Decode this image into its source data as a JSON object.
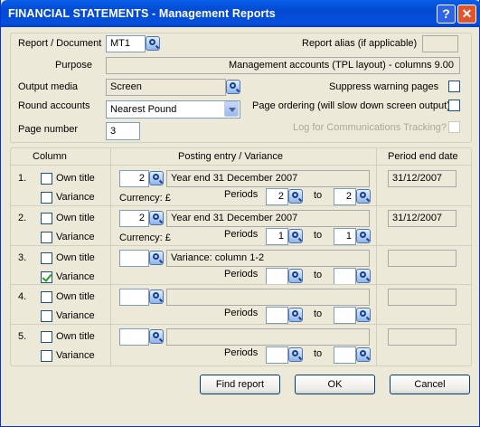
{
  "window": {
    "title": "FINANCIAL STATEMENTS - Management Reports",
    "help_label": "?",
    "close_label": "✕"
  },
  "header": {
    "report_document_label": "Report / Document",
    "report_document_value": "MT1",
    "report_alias_label": "Report alias (if applicable)",
    "report_alias_value": "",
    "purpose_label": "Purpose",
    "purpose_value": "Management accounts (TPL layout) - columns 9.00",
    "output_media_label": "Output media",
    "output_media_value": "Screen",
    "suppress_label": "Suppress warning pages",
    "round_accounts_label": "Round accounts",
    "round_accounts_value": "Nearest Pound",
    "page_ordering_label": "Page ordering (will slow down screen output)",
    "page_number_label": "Page number",
    "page_number_value": "3",
    "log_label": "Log for Communications Tracking?"
  },
  "table": {
    "col_column": "Column",
    "col_posting": "Posting entry / Variance",
    "col_period_end": "Period end date",
    "own_title_label": "Own title",
    "variance_label": "Variance",
    "currency_label": "Currency: £",
    "periods_label": "Periods",
    "to_label": "to",
    "rows": [
      {
        "num": "1.",
        "own_title": false,
        "variance": false,
        "entry": "2",
        "description": "Year end 31 December 2007",
        "has_currency": true,
        "period_from": "2",
        "period_to": "2",
        "period_end": "31/12/2007"
      },
      {
        "num": "2.",
        "own_title": false,
        "variance": false,
        "entry": "2",
        "description": "Year end 31 December 2007",
        "has_currency": true,
        "period_from": "1",
        "period_to": "1",
        "period_end": "31/12/2007"
      },
      {
        "num": "3.",
        "own_title": false,
        "variance": true,
        "entry": "",
        "description": "Variance: column 1-2",
        "has_currency": false,
        "period_from": "",
        "period_to": "",
        "period_end": ""
      },
      {
        "num": "4.",
        "own_title": false,
        "variance": false,
        "entry": "",
        "description": "",
        "has_currency": false,
        "period_from": "",
        "period_to": "",
        "period_end": ""
      },
      {
        "num": "5.",
        "own_title": false,
        "variance": false,
        "entry": "",
        "description": "",
        "has_currency": false,
        "period_from": "",
        "period_to": "",
        "period_end": ""
      }
    ]
  },
  "buttons": {
    "find_report": "Find report",
    "ok": "OK",
    "cancel": "Cancel"
  }
}
